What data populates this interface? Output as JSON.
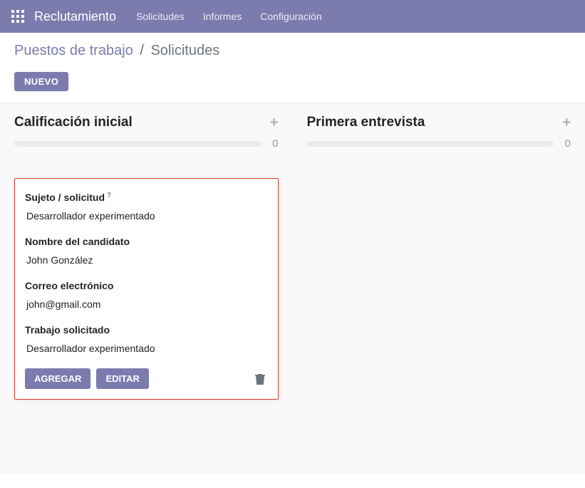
{
  "topnav": {
    "brand": "Reclutamiento",
    "items": [
      "Solicitudes",
      "Informes",
      "Configuración"
    ]
  },
  "header": {
    "breadcrumb_root": "Puestos de trabajo",
    "breadcrumb_sep": "/",
    "breadcrumb_current": "Solicitudes",
    "new_button": "NUEVO"
  },
  "columns": [
    {
      "title": "Calificación inicial",
      "count": "0"
    },
    {
      "title": "Primera entrevista",
      "count": "0"
    }
  ],
  "quick_create": {
    "fields": {
      "subject": {
        "label": "Sujeto / solicitud",
        "help": "?",
        "value": "Desarrollador experimentado"
      },
      "candidate": {
        "label": "Nombre del candidato",
        "value": "John González"
      },
      "email": {
        "label": "Correo electrónico",
        "value": "john@gmail.com"
      },
      "job": {
        "label": "Trabajo solicitado",
        "value": "Desarrollador experimentado"
      }
    },
    "buttons": {
      "add": "AGREGAR",
      "edit": "EDITAR"
    }
  }
}
